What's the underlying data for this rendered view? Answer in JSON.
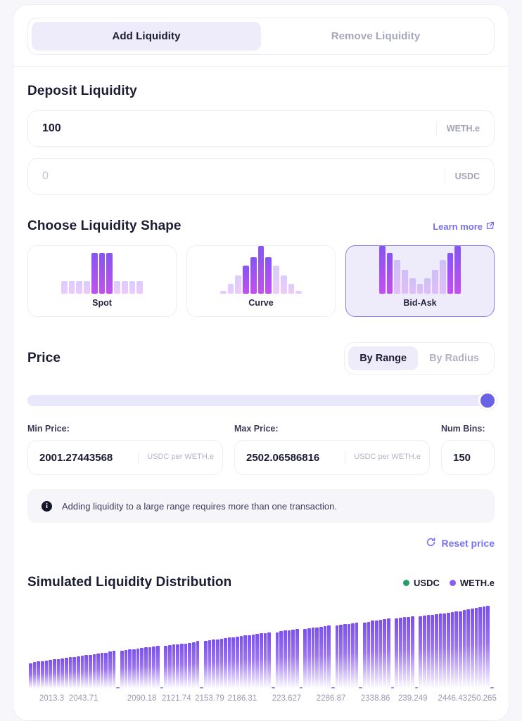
{
  "tabs": [
    {
      "label": "Add Liquidity",
      "active": true
    },
    {
      "label": "Remove Liquidity",
      "active": false
    }
  ],
  "deposit": {
    "title": "Deposit Liquidity",
    "fields": [
      {
        "value": "100",
        "placeholder": "0",
        "token": "WETH.e",
        "filled": true
      },
      {
        "value": "",
        "placeholder": "0",
        "token": "USDC",
        "filled": false
      }
    ]
  },
  "shape": {
    "title": "Choose Liquidity Shape",
    "learn_more": "Learn more",
    "learn_more_icon": "external-link-icon",
    "options": [
      {
        "label": "Spot",
        "selected": false,
        "bars": [
          18,
          18,
          18,
          18,
          58,
          58,
          58,
          18,
          18,
          18,
          18
        ],
        "dim": [
          1,
          1,
          1,
          1,
          0,
          0,
          0,
          1,
          1,
          1,
          1
        ]
      },
      {
        "label": "Curve",
        "selected": false,
        "bars": [
          4,
          14,
          26,
          40,
          52,
          68,
          52,
          40,
          26,
          14,
          4
        ],
        "dim": [
          1,
          1,
          1,
          0,
          0,
          0,
          0,
          1,
          1,
          1,
          1
        ]
      },
      {
        "label": "Bid-Ask",
        "selected": true,
        "bars": [
          68,
          58,
          48,
          34,
          22,
          14,
          22,
          34,
          48,
          58,
          68
        ],
        "dim": [
          0,
          0,
          1,
          1,
          1,
          1,
          1,
          1,
          1,
          0,
          0
        ]
      }
    ]
  },
  "price": {
    "title": "Price",
    "modes": [
      {
        "label": "By Range",
        "active": true
      },
      {
        "label": "By Radius",
        "active": false
      }
    ],
    "slider_value": 100,
    "min_label": "Min Price:",
    "min_value": "2001.27443568",
    "min_unit": "USDC per WETH.e",
    "max_label": "Max Price:",
    "max_value": "2502.06586816",
    "max_unit": "USDC per WETH.e",
    "bins_label": "Num Bins:",
    "bins_value": "150",
    "banner_icon": "info-icon",
    "banner_text": "Adding liquidity to a large range requires more than one transaction.",
    "reset_icon": "refresh-icon",
    "reset_label": "Reset price"
  },
  "colors": {
    "accent": "#7b72ef",
    "bar_top": "#7b4ff0",
    "bar_bottom": "#c44ff0",
    "usdc": "#23a06a",
    "weth": "#8b5cf6",
    "selected_bg": "#eeecfb"
  },
  "chart_data": {
    "type": "bar",
    "title": "Simulated Liquidity Distribution",
    "legend": [
      {
        "name": "USDC",
        "color": "#23a06a"
      },
      {
        "name": "WETH.e",
        "color": "#8b5cf6"
      }
    ],
    "legend_position": "top-right",
    "xlabel": "",
    "ylabel": "",
    "grid": false,
    "xlim": [
      2001.27443568,
      2502.06586816
    ],
    "ylim": [
      0,
      100
    ],
    "tick_labels": [
      "2013.3",
      "2043.71",
      "2090.18",
      "2121.74",
      "2153.79",
      "2186.31",
      "223.627",
      "2286.87",
      "2338.86",
      "239.249",
      "2446.43",
      "250.265"
    ],
    "tick_positions_pct": [
      5.2,
      12.0,
      24.5,
      31.9,
      39.0,
      46.0,
      55.5,
      65.0,
      74.5,
      82.5,
      91.0,
      97.3
    ],
    "series": [
      {
        "name": "WETH.e",
        "values": [
          34,
          35,
          36,
          36,
          37,
          38,
          39,
          39,
          40,
          41,
          42,
          42,
          43,
          44,
          45,
          45,
          46,
          47,
          48,
          48,
          49,
          50,
          2,
          50,
          51,
          52,
          52,
          53,
          54,
          55,
          55,
          56,
          57,
          2,
          57,
          58,
          59,
          59,
          60,
          60,
          61,
          62,
          63,
          2,
          63,
          64,
          65,
          65,
          66,
          67,
          68,
          68,
          69,
          70,
          71,
          71,
          72,
          73,
          74,
          74,
          75,
          2,
          75,
          76,
          77,
          77,
          78,
          79,
          2,
          79,
          80,
          81,
          81,
          82,
          83,
          84,
          2,
          84,
          85,
          86,
          86,
          87,
          88,
          2,
          88,
          89,
          90,
          90,
          91,
          92,
          93,
          2,
          93,
          94,
          95,
          95,
          96,
          2,
          96,
          97,
          98,
          98,
          99,
          100,
          100,
          101,
          102,
          103,
          103,
          104,
          105,
          106,
          107,
          108,
          109,
          110,
          2
        ]
      }
    ]
  }
}
